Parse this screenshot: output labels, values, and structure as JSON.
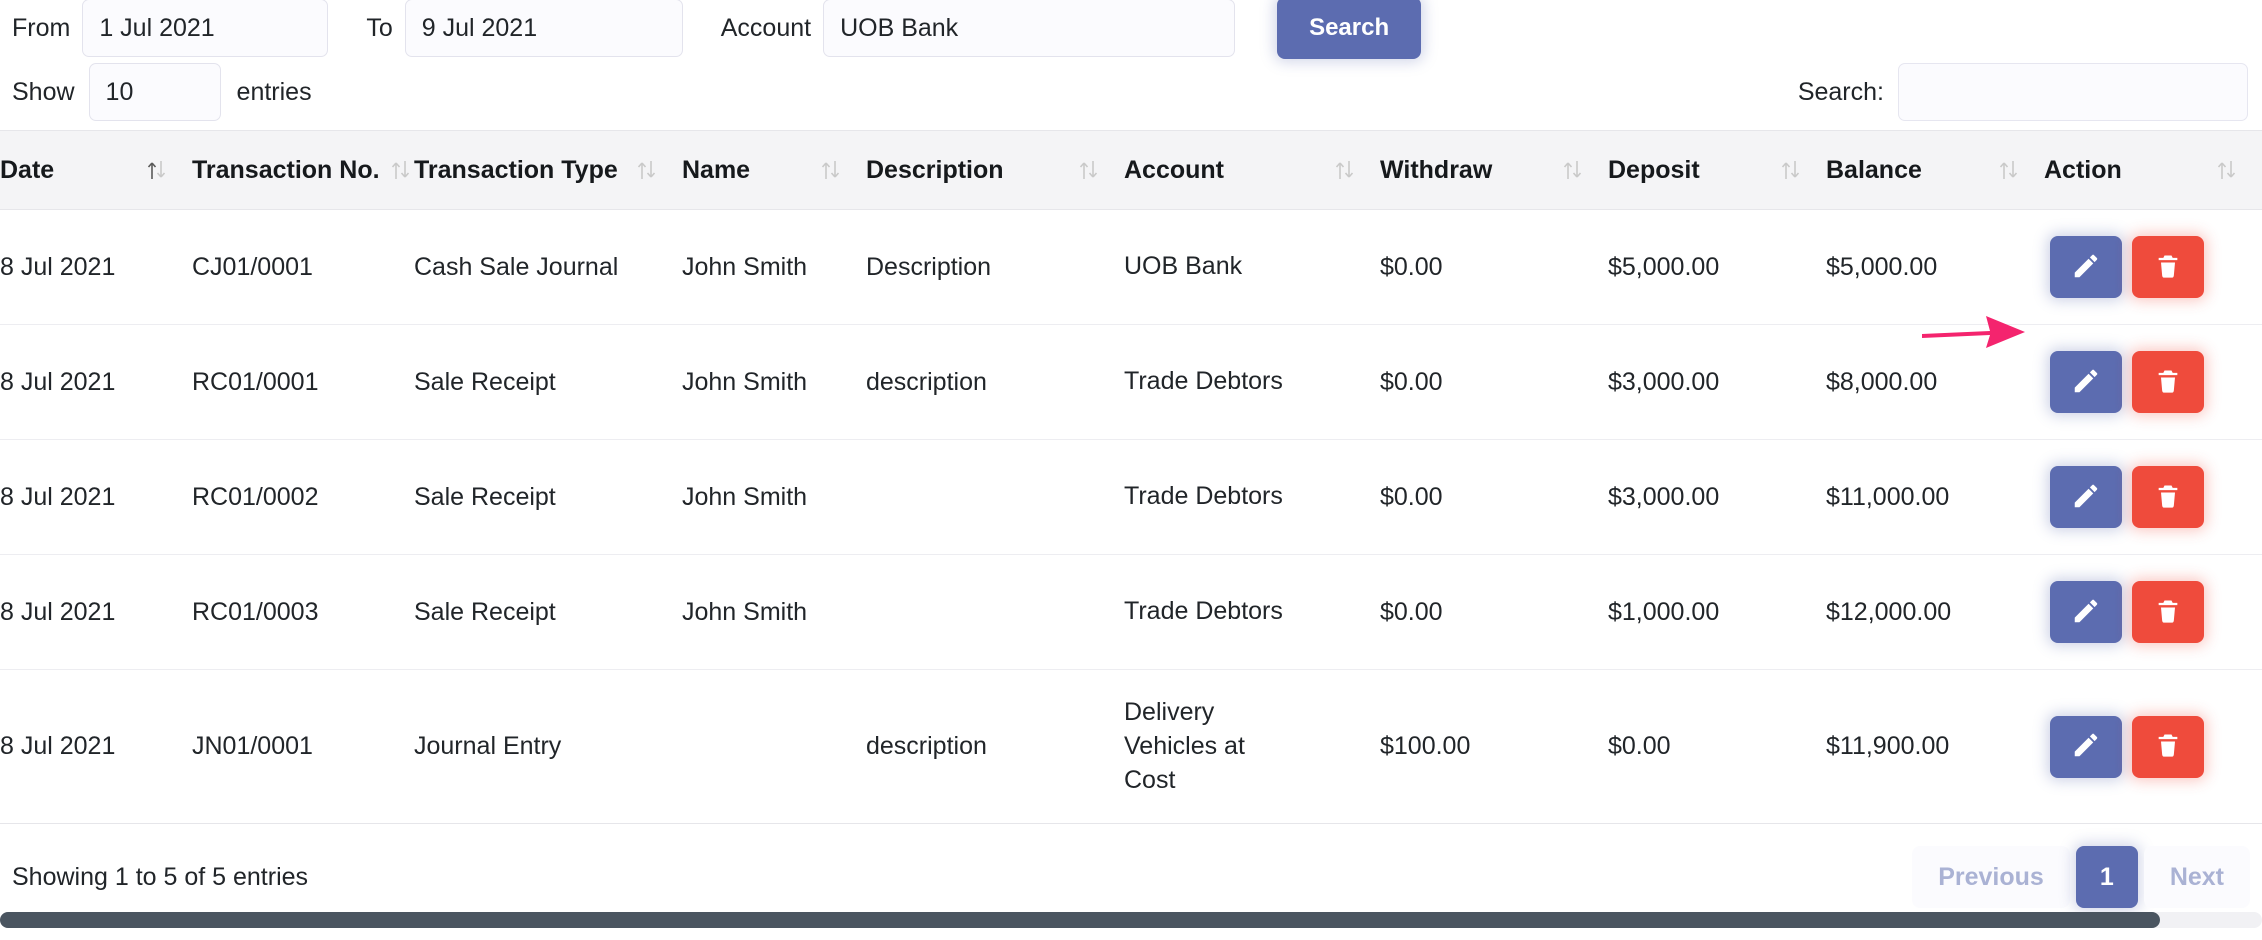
{
  "filters": {
    "from_label": "From",
    "from_value": "1 Jul 2021",
    "to_label": "To",
    "to_value": "9 Jul 2021",
    "account_label": "Account",
    "account_value": "UOB Bank",
    "search_button": "Search"
  },
  "controls": {
    "show_label": "Show",
    "entries_value": "10",
    "entries_label": "entries",
    "search_label": "Search:",
    "search_value": ""
  },
  "table": {
    "columns": [
      "Date",
      "Transaction No.",
      "Transaction Type",
      "Name",
      "Description",
      "Account",
      "Withdraw",
      "Deposit",
      "Balance",
      "Action"
    ],
    "rows": [
      {
        "date": "8 Jul 2021",
        "transaction_no": "CJ01/0001",
        "transaction_type": "Cash Sale Journal",
        "name": "John Smith",
        "description": "Description",
        "account": "UOB Bank",
        "withdraw": "$0.00",
        "deposit": "$5,000.00",
        "balance": "$5,000.00"
      },
      {
        "date": "8 Jul 2021",
        "transaction_no": "RC01/0001",
        "transaction_type": "Sale Receipt",
        "name": "John Smith",
        "description": "description",
        "account": "Trade Debtors",
        "withdraw": "$0.00",
        "deposit": "$3,000.00",
        "balance": "$8,000.00"
      },
      {
        "date": "8 Jul 2021",
        "transaction_no": "RC01/0002",
        "transaction_type": "Sale Receipt",
        "name": "John Smith",
        "description": "",
        "account": "Trade Debtors",
        "withdraw": "$0.00",
        "deposit": "$3,000.00",
        "balance": "$11,000.00"
      },
      {
        "date": "8 Jul 2021",
        "transaction_no": "RC01/0003",
        "transaction_type": "Sale Receipt",
        "name": "John Smith",
        "description": "",
        "account": "Trade Debtors",
        "withdraw": "$0.00",
        "deposit": "$1,000.00",
        "balance": "$12,000.00"
      },
      {
        "date": "8 Jul 2021",
        "transaction_no": "JN01/0001",
        "transaction_type": "Journal Entry",
        "name": "",
        "description": "description",
        "account": "Delivery Vehicles at Cost",
        "withdraw": "$100.00",
        "deposit": "$0.00",
        "balance": "$11,900.00"
      }
    ]
  },
  "footer": {
    "info": "Showing 1 to 5 of 5 entries",
    "previous": "Previous",
    "page_current": "1",
    "next": "Next"
  },
  "icons": {
    "sort": "sort-icon",
    "edit": "pencil-icon",
    "delete": "trash-icon",
    "annotation": "arrow-right-annotation"
  },
  "colors": {
    "primary": "#5c6cb0",
    "danger": "#ef4b3c",
    "annotation": "#f4246e",
    "header_bg": "#f4f4f6",
    "scrollbar": "#4a5560"
  }
}
